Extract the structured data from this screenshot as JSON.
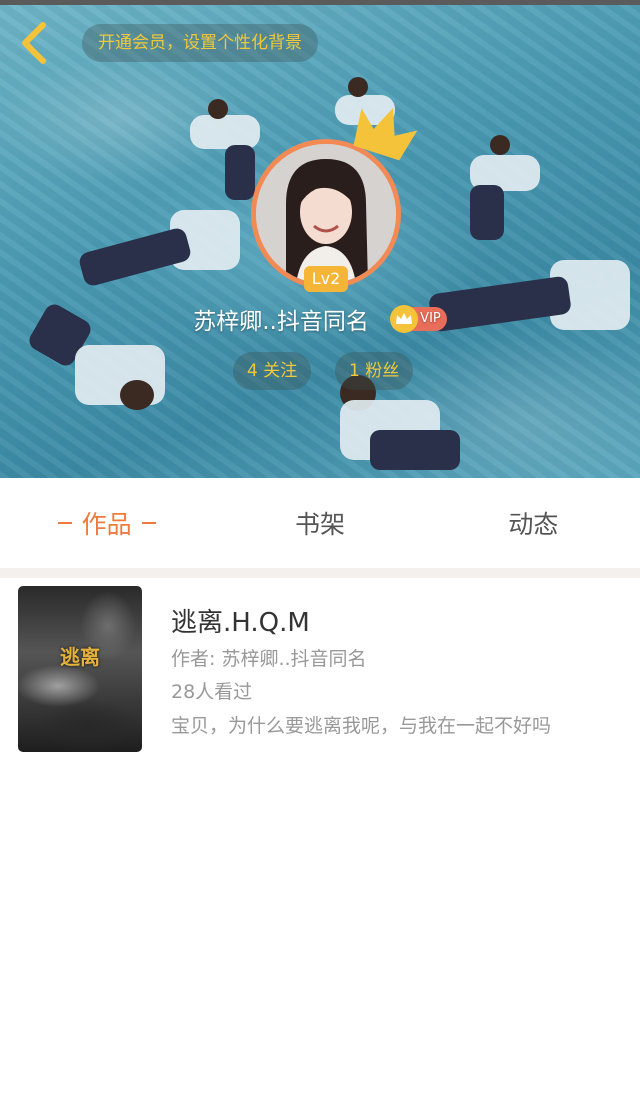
{
  "header": {
    "vip_background_prompt": "开通会员，设置个性化背景"
  },
  "profile": {
    "level": "Lv2",
    "username": "苏梓卿..抖音同名",
    "vip_label": "VIP",
    "following": "4 关注",
    "fans": "1 粉丝"
  },
  "tabs": [
    {
      "label": "作品",
      "active": true
    },
    {
      "label": "书架",
      "active": false
    },
    {
      "label": "动态",
      "active": false
    }
  ],
  "works": [
    {
      "cover_text": "逃离",
      "title": "逃离.H.Q.M",
      "author": "作者: 苏梓卿..抖音同名",
      "views": "28人看过",
      "description": "宝贝，为什么要逃离我呢，与我在一起不好吗"
    }
  ],
  "colors": {
    "accent": "#f07a3d",
    "gold": "#f0c93a",
    "avatar_border": "#f28a55",
    "level_badge": "#f5b536",
    "vip_tag": "#e86d5a"
  },
  "icons": {
    "back": "chevron-left-icon",
    "crown": "crown-icon",
    "vip": "vip-crown-icon"
  }
}
